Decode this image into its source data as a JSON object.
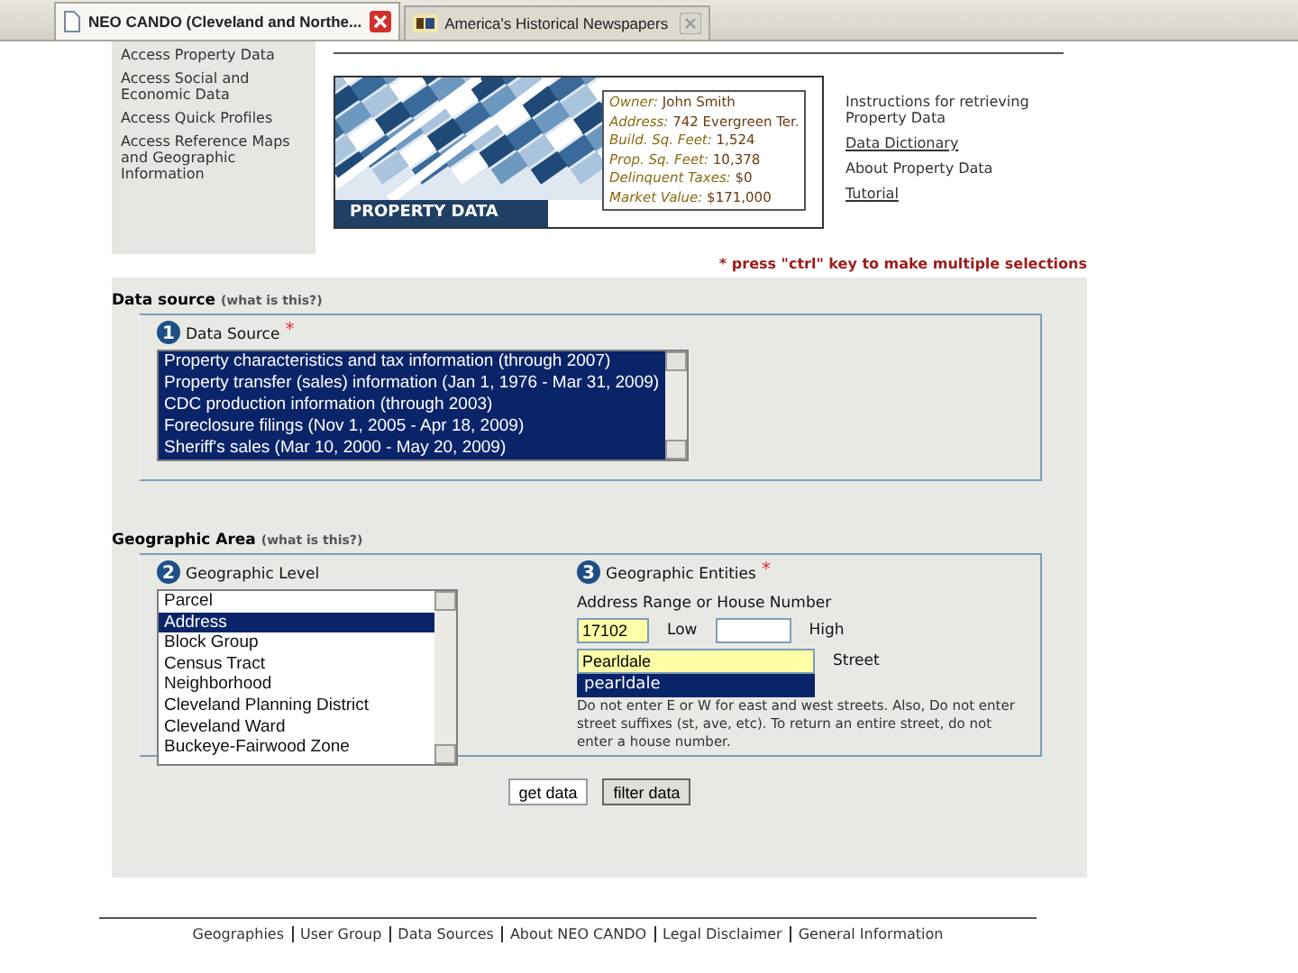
{
  "browser_tabs": [
    {
      "label": "NEO CANDO (Cleveland and Northe...",
      "selected": true
    },
    {
      "label": "America's Historical Newspapers",
      "selected": false
    }
  ],
  "sidebar": {
    "items": [
      "Access Property Data",
      "Access Social and Economic Data",
      "Access Quick Profiles",
      "Access Reference Maps and Geographic Information"
    ]
  },
  "banner": {
    "title": "PROPERTY DATA",
    "callout": [
      {
        "label": "Owner:",
        "value": "John Smith"
      },
      {
        "label": "Address:",
        "value": "742 Evergreen Ter."
      },
      {
        "label": "Build. Sq. Feet:",
        "value": "1,524"
      },
      {
        "label": "Prop. Sq. Feet:",
        "value": "10,378"
      },
      {
        "label": "Delinquent Taxes:",
        "value": "$0"
      },
      {
        "label": "Market Value:",
        "value": "$171,000"
      }
    ]
  },
  "links": [
    {
      "label": "Instructions for retrieving Property Data",
      "underlined": false
    },
    {
      "label": "Data Dictionary",
      "underlined": true
    },
    {
      "label": "About Property Data",
      "underlined": false
    },
    {
      "label": "Tutorial",
      "underlined": true
    }
  ],
  "note": "* press \"ctrl\" key to make multiple selections",
  "data_source": {
    "heading": "Data source",
    "help": "(what is this?)",
    "step": "1",
    "label": "Data Source",
    "required": "*",
    "options": [
      {
        "label": "Property characteristics and tax information (through 2007)",
        "selected": true
      },
      {
        "label": "Property transfer (sales) information (Jan 1, 1976 - Mar 31, 2009)",
        "selected": true
      },
      {
        "label": "CDC production information (through 2003)",
        "selected": true
      },
      {
        "label": "Foreclosure filings (Nov 1, 2005 - Apr 18, 2009)",
        "selected": true
      },
      {
        "label": "Sheriff's sales (Mar 10, 2000 - May 20, 2009)",
        "selected": true
      }
    ]
  },
  "geographic_area": {
    "heading": "Geographic Area",
    "help": "(what is this?)",
    "level": {
      "step": "2",
      "label": "Geographic Level",
      "options": [
        {
          "label": "Parcel",
          "selected": false
        },
        {
          "label": "Address",
          "selected": true
        },
        {
          "label": "Block Group",
          "selected": false
        },
        {
          "label": "Census Tract",
          "selected": false
        },
        {
          "label": "Neighborhood",
          "selected": false
        },
        {
          "label": "Cleveland Planning District",
          "selected": false
        },
        {
          "label": "Cleveland Ward",
          "selected": false
        },
        {
          "label": "Buckeye-Fairwood Zone",
          "selected": false
        }
      ]
    },
    "entities": {
      "step": "3",
      "label": "Geographic Entities",
      "required": "*",
      "range_label": "Address Range or House Number",
      "low_value": "17102",
      "low_label": "Low",
      "high_label": "High",
      "street_value": "Pearldale",
      "street_label": "Street",
      "suggestion": "pearldale",
      "hint": "Do not enter E or W for east and west streets. Also, Do not enter street suffixes (st, ave, etc). To return an entire street, do not enter a house number."
    }
  },
  "buttons": [
    "get data",
    "filter data"
  ],
  "footer": {
    "links": [
      "Geographies",
      "User Group",
      "Data Sources",
      "About NEO CANDO",
      "Legal Disclaimer",
      "General Information"
    ]
  }
}
